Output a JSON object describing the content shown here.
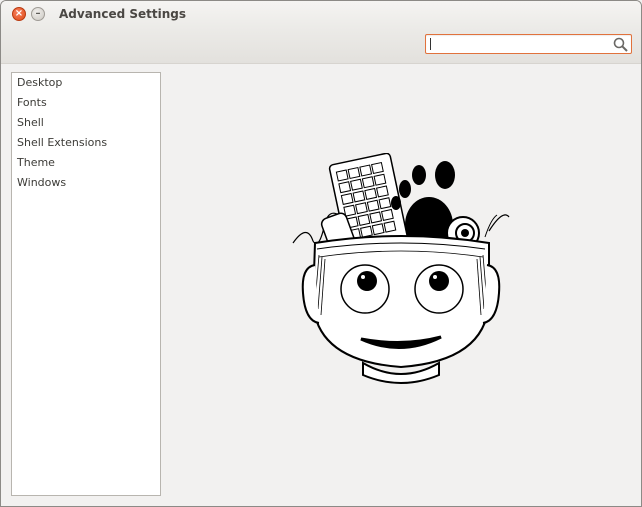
{
  "window": {
    "title": "Advanced Settings",
    "close_icon": "close-icon",
    "minimize_icon": "minimize-icon"
  },
  "toolbar": {
    "search": {
      "value": "",
      "placeholder": "",
      "icon": "search-icon"
    }
  },
  "sidebar": {
    "items": [
      {
        "label": "Desktop"
      },
      {
        "label": "Fonts"
      },
      {
        "label": "Shell"
      },
      {
        "label": "Shell Extensions"
      },
      {
        "label": "Theme"
      },
      {
        "label": "Windows"
      }
    ]
  },
  "main": {
    "illustration": "gnome-tweak-robot-head-icon"
  },
  "colors": {
    "accent": "#e1723c",
    "close_button": "#df4b16",
    "window_bg": "#f2f1f0"
  }
}
